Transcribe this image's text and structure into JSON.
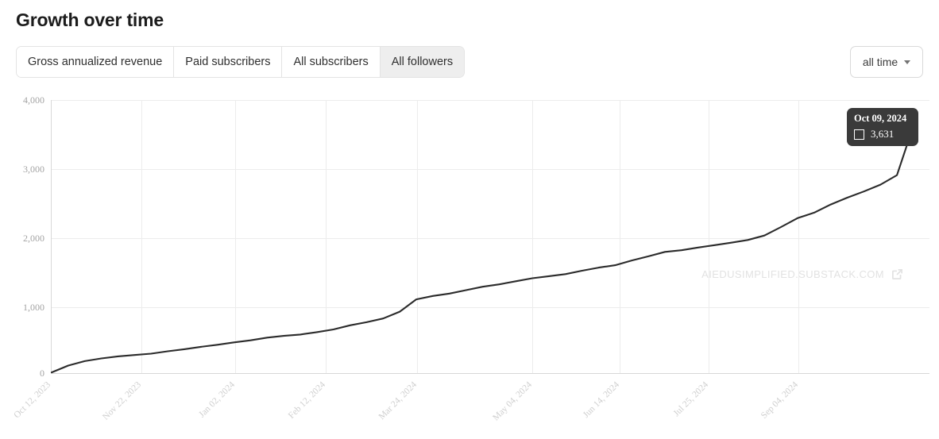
{
  "header": {
    "title": "Growth over time"
  },
  "tabs": [
    {
      "label": "Gross annualized revenue",
      "selected": false
    },
    {
      "label": "Paid subscribers",
      "selected": false
    },
    {
      "label": "All subscribers",
      "selected": false
    },
    {
      "label": "All followers",
      "selected": true
    }
  ],
  "range_selector": {
    "value": "all time",
    "icon": "chevron-down-icon"
  },
  "tooltip": {
    "date": "Oct 09, 2024",
    "value": "3,631",
    "swatch_icon": "square-outline-icon"
  },
  "watermark": {
    "text": "AIEDUSIMPLIFIED.SUBSTACK.COM",
    "icon": "external-link-icon"
  },
  "colors": {
    "line": "#2b2b2b",
    "grid": "#ececec",
    "tooltip_bg": "#3a3a3a",
    "tab_selected_bg": "#eeeeee",
    "title": "#1c1c1c",
    "watermark": "#e2e2e2"
  },
  "chart_data": {
    "type": "line",
    "title": "Growth over time",
    "xlabel": "",
    "ylabel": "",
    "ylim": [
      0,
      4000
    ],
    "yticks": [
      "0",
      "1,000",
      "2,000",
      "3,000",
      "4,000"
    ],
    "ytick_values": [
      0,
      1000,
      2000,
      3000,
      4000
    ],
    "xticks": [
      "Oct 12, 2023",
      "Nov 22, 2023",
      "Jan 02, 2024",
      "Feb 12, 2024",
      "Mar 24, 2024",
      "May 04, 2024",
      "Jun 14, 2024",
      "Jul 25, 2024",
      "Sep 04, 2024"
    ],
    "grid": true,
    "legend_position": "none",
    "series": [
      {
        "name": "All followers",
        "x": [
          "Oct 12, 2023",
          "Oct 19, 2023",
          "Oct 26, 2023",
          "Nov 02, 2023",
          "Nov 09, 2023",
          "Nov 16, 2023",
          "Nov 22, 2023",
          "Nov 30, 2023",
          "Dec 07, 2023",
          "Dec 14, 2023",
          "Dec 21, 2023",
          "Dec 28, 2023",
          "Jan 02, 2024",
          "Jan 11, 2024",
          "Jan 18, 2024",
          "Jan 25, 2024",
          "Feb 01, 2024",
          "Feb 08, 2024",
          "Feb 12, 2024",
          "Feb 19, 2024",
          "Feb 26, 2024",
          "Mar 04, 2024",
          "Mar 11, 2024",
          "Mar 18, 2024",
          "Mar 24, 2024",
          "Apr 01, 2024",
          "Apr 08, 2024",
          "Apr 15, 2024",
          "Apr 22, 2024",
          "Apr 29, 2024",
          "May 04, 2024",
          "May 13, 2024",
          "May 20, 2024",
          "May 27, 2024",
          "Jun 03, 2024",
          "Jun 10, 2024",
          "Jun 14, 2024",
          "Jun 24, 2024",
          "Jul 01, 2024",
          "Jul 08, 2024",
          "Jul 15, 2024",
          "Jul 22, 2024",
          "Jul 25, 2024",
          "Aug 05, 2024",
          "Aug 12, 2024",
          "Aug 19, 2024",
          "Aug 26, 2024",
          "Sep 04, 2024",
          "Sep 12, 2024",
          "Sep 19, 2024",
          "Sep 26, 2024",
          "Oct 03, 2024",
          "Oct 09, 2024"
        ],
        "values": [
          10,
          110,
          175,
          215,
          245,
          265,
          285,
          320,
          350,
          385,
          415,
          450,
          480,
          520,
          545,
          565,
          600,
          640,
          700,
          745,
          800,
          900,
          1080,
          1130,
          1165,
          1215,
          1265,
          1300,
          1345,
          1390,
          1420,
          1450,
          1500,
          1545,
          1580,
          1650,
          1710,
          1775,
          1800,
          1840,
          1875,
          1910,
          1950,
          2015,
          2140,
          2270,
          2350,
          2470,
          2570,
          2660,
          2760,
          2900,
          3631
        ],
        "final_value": 3631,
        "final_label": "3,631"
      }
    ]
  }
}
